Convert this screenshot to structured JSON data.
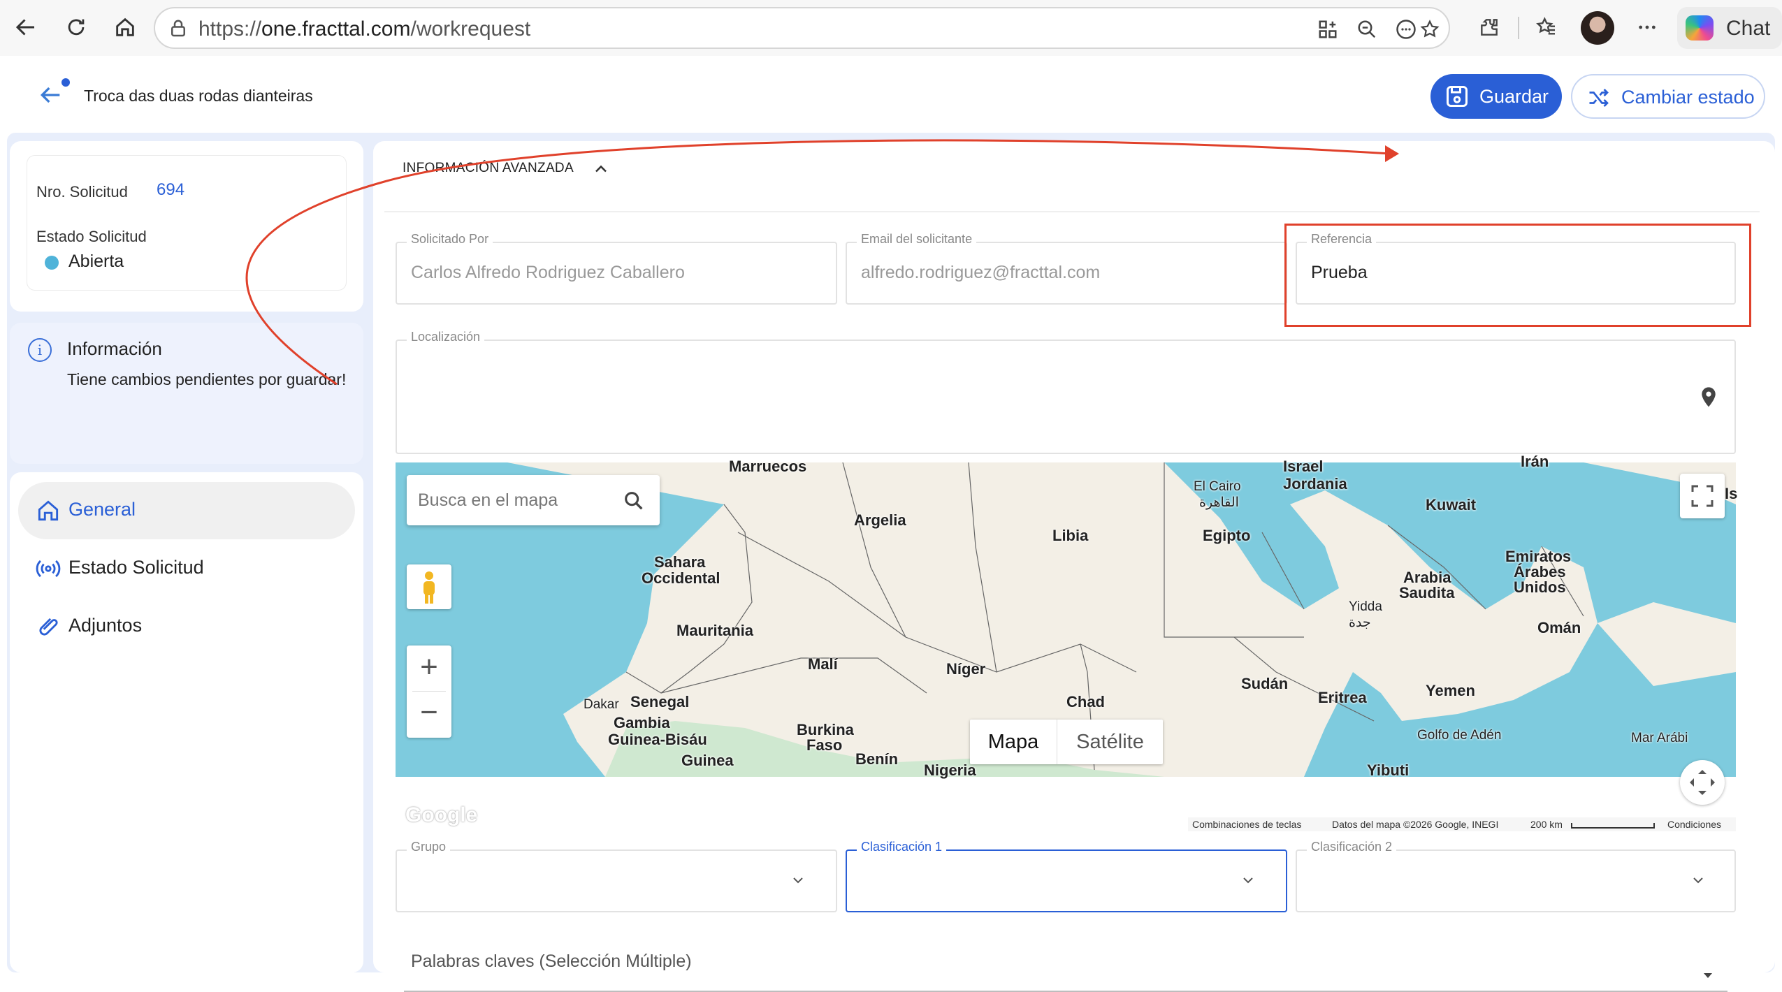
{
  "browser": {
    "url_prefix": "https://",
    "url_host": "one.fracttal.com",
    "url_path": "/workrequest",
    "chat_label": "Chat"
  },
  "header": {
    "title": "Troca das duas rodas dianteiras",
    "save_label": "Guardar",
    "change_state_label": "Cambiar estado"
  },
  "summary": {
    "nro_label": "Nro. Solicitud",
    "nro_value": "694",
    "estado_label": "Estado Solicitud",
    "estado_value": "Abierta",
    "estado_color": "#4fb3d9"
  },
  "info": {
    "title": "Información",
    "text": "Tiene cambios pendientes por guardar!"
  },
  "nav": {
    "items": [
      {
        "label": "General",
        "icon": "home-icon",
        "active": true
      },
      {
        "label": "Estado Solicitud",
        "icon": "broadcast-icon",
        "active": false
      },
      {
        "label": "Adjuntos",
        "icon": "paperclip-icon",
        "active": false
      }
    ]
  },
  "section": {
    "title": "INFORMACIÓN AVANZADA"
  },
  "form": {
    "solicitado_por": {
      "label": "Solicitado Por",
      "value": "Carlos Alfredo Rodriguez Caballero"
    },
    "email": {
      "label": "Email del solicitante",
      "value": "alfredo.rodriguez@fracttal.com"
    },
    "referencia": {
      "label": "Referencia",
      "value": "Prueba"
    },
    "localizacion": {
      "label": "Localización",
      "value": ""
    },
    "grupo": {
      "label": "Grupo",
      "value": ""
    },
    "clasificacion1": {
      "label": "Clasificación 1",
      "value": ""
    },
    "clasificacion2": {
      "label": "Clasificación 2",
      "value": ""
    },
    "palabras_claves": {
      "label": "Palabras claves (Selección Múltiple)"
    }
  },
  "map": {
    "search_placeholder": "Busca en el mapa",
    "type_map": "Mapa",
    "type_satellite": "Satélite",
    "logo": "Google",
    "footer_shortcuts": "Combinaciones de teclas",
    "footer_data": "Datos del mapa ©2026 Google, INEGI",
    "footer_scale": "200 km",
    "footer_terms": "Condiciones",
    "labels": {
      "marruecos": "Marruecos",
      "argelia": "Argelia",
      "libia": "Libia",
      "egipto": "Egipto",
      "sahara1": "Sahara",
      "sahara2": "Occidental",
      "mauritania": "Mauritania",
      "mali": "Malí",
      "niger": "Níger",
      "chad": "Chad",
      "sudan": "Sudán",
      "senegal": "Senegal",
      "dakar": "Dakar",
      "gambia": "Gambia",
      "guinea_bissau": "Guinea-Bisáu",
      "guinea": "Guinea",
      "burkina1": "Burkina",
      "burkina2": "Faso",
      "benin": "Benín",
      "nigeria": "Nigeria",
      "israel": "Israel",
      "jordania": "Jordania",
      "el_cairo": "El Cairo",
      "el_cairo_ar": "القاهرة",
      "kuwait": "Kuwait",
      "arabia1": "Arabia",
      "arabia2": "Saudita",
      "emiratos1": "Emiratos",
      "emiratos2": "Árabes",
      "emiratos3": "Unidos",
      "yidda": "Yidda",
      "yidda_ar": "جدة",
      "oman": "Omán",
      "eritrea": "Eritrea",
      "yemen": "Yemen",
      "yibuti": "Yibuti",
      "golfo_aden": "Golfo de Adén",
      "mar_arabia": "Mar Arábi",
      "iran": "Irán",
      "iraq_edge": "Is"
    }
  }
}
